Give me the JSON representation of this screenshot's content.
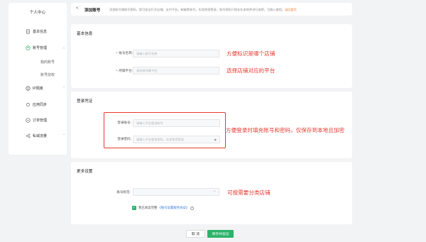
{
  "sidebar": {
    "title": "个人中心",
    "items": [
      {
        "label": "基本信息"
      },
      {
        "label": "账号管理"
      },
      {
        "label": "我的账号"
      },
      {
        "label": "账号授权"
      },
      {
        "label": "IP隔离"
      },
      {
        "label": "应用同步"
      },
      {
        "label": "订单管理"
      },
      {
        "label": "私域流量"
      }
    ]
  },
  "header": {
    "back": "<",
    "title": "添加账号",
    "description": "添加账号储账号密码，即可安全打开店铺，支付平台，邮箱等账号，实现免密登录；账号密码只保存在本地并进行加密，可放心使用。",
    "link": "返回首页"
  },
  "basic": {
    "title": "基本信息",
    "account_name_label": "账号名称:",
    "account_name_placeholder": "请输入账号名称",
    "platform_label": "所属平台:",
    "platform_placeholder": "请选择所属平台",
    "annotation_name": "方便标识是哪个店铺",
    "annotation_platform": "选择店铺对应的平台"
  },
  "login": {
    "title": "登录凭证",
    "account_label": "登录账号:",
    "account_placeholder": "请输入平台登录账号",
    "password_label": "登录密码:",
    "password_placeholder": "请输入平台登录密码，实现免密登录",
    "annotation": "方便登录时填充账号和密码，仅保存到本地且加密"
  },
  "more": {
    "title": "更多设置",
    "tag_label": "账号标签:",
    "annotation": "可按需要分类店铺",
    "agree_text": "我已阅读完整",
    "agree_link": "《账号设置服务协议》"
  },
  "buttons": {
    "cancel": "取 消",
    "save": "保存并验证"
  },
  "colors": {
    "accent": "#2bb36a",
    "annotation": "#e8382f",
    "link": "#f07a2a"
  }
}
